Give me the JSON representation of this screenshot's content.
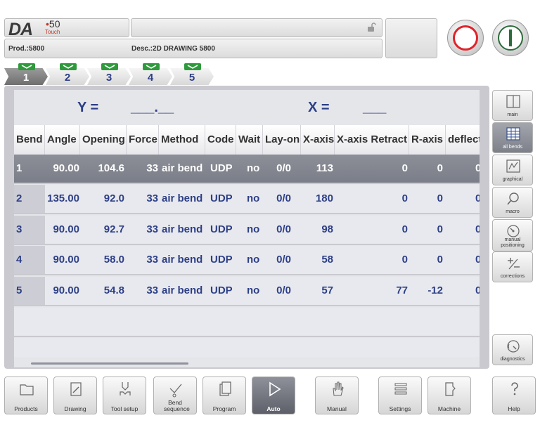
{
  "brand": {
    "logo_main": "DA",
    "logo_number": "50",
    "logo_sub": "Touch"
  },
  "header": {
    "prod_label": "Prod.:5800",
    "desc_label": "Desc.:2D DRAWING 5800"
  },
  "machine_buttons": {
    "stop": "stop-button",
    "start": "start-button"
  },
  "bend_tabs": [
    {
      "label": "1",
      "active": true
    },
    {
      "label": "2",
      "active": false
    },
    {
      "label": "3",
      "active": false
    },
    {
      "label": "4",
      "active": false
    },
    {
      "label": "5",
      "active": false
    }
  ],
  "axis_readout": {
    "y_label": "Y =",
    "y_value": "___.__",
    "x_label": "X =",
    "x_value": "___"
  },
  "table": {
    "headers": [
      "Bend",
      "Angle",
      "Opening",
      "Force",
      "Method",
      "Code",
      "Wait",
      "Lay-on",
      "X-axis",
      "X-axis Retract",
      "R-axis",
      "deflect"
    ],
    "rows": [
      [
        "1",
        "90.00",
        "104.6",
        "33",
        "air bend",
        "UDP",
        "no",
        "0/0",
        "113",
        "0",
        "0",
        "0"
      ],
      [
        "2",
        "135.00",
        "92.0",
        "33",
        "air bend",
        "UDP",
        "no",
        "0/0",
        "180",
        "0",
        "0",
        "0"
      ],
      [
        "3",
        "90.00",
        "92.7",
        "33",
        "air bend",
        "UDP",
        "no",
        "0/0",
        "98",
        "0",
        "0",
        "0"
      ],
      [
        "4",
        "90.00",
        "58.0",
        "33",
        "air bend",
        "UDP",
        "no",
        "0/0",
        "58",
        "0",
        "0",
        "0"
      ],
      [
        "5",
        "90.00",
        "54.8",
        "33",
        "air bend",
        "UDP",
        "no",
        "0/0",
        "57",
        "77",
        "-12",
        "0"
      ]
    ],
    "selected_row": 1
  },
  "side_nav": [
    {
      "label": "main",
      "icon": "window-icon"
    },
    {
      "label": "all bends",
      "icon": "table-grid-icon"
    },
    {
      "label": "graphical",
      "icon": "graphical-icon"
    },
    {
      "label": "macro",
      "icon": "magnifier-icon"
    },
    {
      "label": "manual positioning",
      "icon": "dial-icon"
    },
    {
      "label": "corrections",
      "icon": "plus-minus-icon"
    },
    {
      "label": "diagnostics",
      "icon": "gauge-icon"
    }
  ],
  "bottom_nav": [
    {
      "label": "Products",
      "icon": "folder-icon"
    },
    {
      "label": "Drawing",
      "icon": "pencil-icon"
    },
    {
      "label": "Tool setup",
      "icon": "punch-die-icon"
    },
    {
      "label": "Bend sequence",
      "icon": "bend-sequence-icon"
    },
    {
      "label": "Program",
      "icon": "pages-icon"
    },
    {
      "label": "Auto",
      "icon": "play-icon"
    },
    {
      "label": "Manual",
      "icon": "hand-icon"
    },
    {
      "label": "Settings",
      "icon": "list-icon"
    },
    {
      "label": "Machine",
      "icon": "machine-icon"
    },
    {
      "label": "Help",
      "icon": "question-icon"
    }
  ],
  "colors": {
    "accent_blue": "#2d3f86",
    "stop_red": "#e0242a",
    "start_green": "#2d6b3c",
    "tab_indicator_green": "#2e9a3c",
    "selected_row": "#7b7e88"
  }
}
